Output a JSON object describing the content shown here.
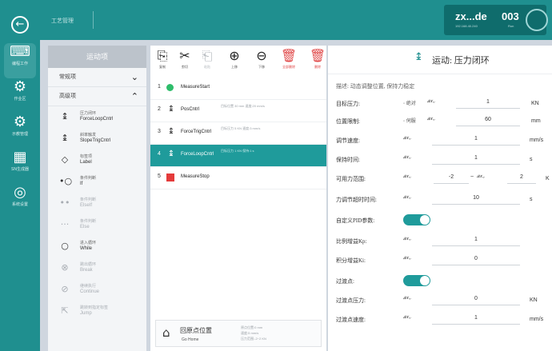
{
  "colors": {
    "accent": "#1f8f8f",
    "selected": "#1f9b9b",
    "danger": "#e04848",
    "start": "#2ebd6b",
    "stop": "#e43b3b"
  },
  "rail": {
    "back_icon": "back-icon",
    "items": [
      {
        "icon": "program-icon",
        "glyph": "⌨",
        "label": "编程工作"
      },
      {
        "icon": "robot-arm-icon",
        "glyph": "⚙",
        "label": "作业区"
      },
      {
        "icon": "devices-icon",
        "glyph": "⚙",
        "label": "示教管理"
      },
      {
        "icon": "barcode-icon",
        "glyph": "▦",
        "label": "SN生成器"
      },
      {
        "icon": "settings-icon",
        "glyph": "◎",
        "label": "系统设置"
      }
    ]
  },
  "topbar": {
    "title": "工艺管理"
  },
  "device": {
    "name": "zx...de",
    "ip": "192.168.40.240",
    "number": "003",
    "number_sub": "Run"
  },
  "left_panel": {
    "title": "运动项",
    "categories": [
      {
        "label": "常规项",
        "chevron": "⌄"
      },
      {
        "label": "高级项",
        "chevron": "⌃"
      }
    ],
    "commands": [
      {
        "icon": "force-loop-icon",
        "glyph": "↨",
        "cn": "压力闭环",
        "en": "ForceLoopCntrl",
        "dim": false
      },
      {
        "icon": "slope-icon",
        "glyph": "↨",
        "cn": "斜率触发",
        "en": "SlopeTrigCntrl",
        "dim": false
      },
      {
        "icon": "label-icon",
        "glyph": "◇",
        "cn": "标签项",
        "en": "Label",
        "dim": false
      },
      {
        "icon": "if-icon",
        "glyph": "•○",
        "cn": "条件判断",
        "en": "If",
        "dim": false
      },
      {
        "icon": "elseif-icon",
        "glyph": "••",
        "cn": "条件判断",
        "en": "ElseIf",
        "dim": true
      },
      {
        "icon": "else-icon",
        "glyph": "···",
        "cn": "条件判断",
        "en": "Else",
        "dim": true
      },
      {
        "icon": "while-icon",
        "glyph": "○",
        "cn": "进入循环",
        "en": "While",
        "dim": false
      },
      {
        "icon": "break-icon",
        "glyph": "⊗",
        "cn": "跳出循环",
        "en": "Break",
        "dim": true
      },
      {
        "icon": "continue-icon",
        "glyph": "⊘",
        "cn": "继续执行",
        "en": "Continue",
        "dim": true
      },
      {
        "icon": "jump-icon",
        "glyph": "⇱",
        "cn": "跳转到指定标签",
        "en": "Jump",
        "dim": true
      }
    ]
  },
  "toolbar": {
    "buttons": [
      {
        "icon": "copy-icon",
        "glyph": "⎘",
        "label": "复制",
        "state": "normal"
      },
      {
        "icon": "cut-icon",
        "glyph": "✂",
        "label": "剪切",
        "state": "normal"
      },
      {
        "icon": "paste-icon",
        "glyph": "⎗",
        "label": "粘贴",
        "state": "disabled"
      },
      {
        "icon": "move-up-icon",
        "glyph": "⊕",
        "label": "上移",
        "state": "normal"
      },
      {
        "icon": "move-down-icon",
        "glyph": "⊖",
        "label": "下移",
        "state": "normal"
      },
      {
        "icon": "delete-all-icon",
        "glyph": "🗑",
        "label": "全部删除",
        "state": "danger"
      },
      {
        "icon": "delete-icon",
        "glyph": "🗑",
        "label": "删除",
        "state": "danger"
      }
    ]
  },
  "program": {
    "rows": [
      {
        "index": "1",
        "icon": "start-icon",
        "glyph": "",
        "style": "green",
        "name": "MeasureStart",
        "detail": "",
        "selected": false
      },
      {
        "index": "2",
        "icon": "pos-icon",
        "glyph": "↨",
        "style": "",
        "name": "PosCntrl",
        "detail": "目标位置 30 mm 速度:20 mm/s",
        "selected": false
      },
      {
        "index": "3",
        "icon": "force-trig-icon",
        "glyph": "↨",
        "style": "",
        "name": "ForceTrigCntrl",
        "detail": "目标压力 5 KN 速度:3 mm/s",
        "selected": false
      },
      {
        "index": "4",
        "icon": "force-loop-icon",
        "glyph": "↨",
        "style": "",
        "name": "ForceLoopCntrl",
        "detail": "目标压力 1 KN 保持:1 s",
        "selected": true
      },
      {
        "index": "5",
        "icon": "stop-icon",
        "glyph": "",
        "style": "red",
        "name": "MeasureStop",
        "detail": "",
        "selected": false
      }
    ],
    "go_home": {
      "icon": "home-icon",
      "glyph": "⌂",
      "cn": "回原点位置",
      "en": "Go Home",
      "info1": "原点位置:0 mm",
      "info2": "速度:5 mm/s",
      "info3": "压力范围:-2~2 KN"
    }
  },
  "params": {
    "icon": "force-loop-icon",
    "title": "运动: 压力闭环",
    "description": "描述: 动态调整位置, 保持力稳定",
    "fields": [
      {
        "key": "target_force",
        "label": "目标压力:",
        "mode": "◦ 绝对",
        "value": "1",
        "unit": "KN"
      },
      {
        "key": "position_limit",
        "label": "位置限制:",
        "mode": "◦ 伺服",
        "value": "60",
        "unit": "mm"
      },
      {
        "key": "adjust_speed",
        "label": "调节速度:",
        "mode": "",
        "value": "1",
        "unit": "mm/s"
      },
      {
        "key": "hold_time",
        "label": "保持时间:",
        "mode": "",
        "value": "1",
        "unit": "s"
      },
      {
        "key": "force_range",
        "label": "可用力范围:",
        "mode": "",
        "value": "-2",
        "value2": "2",
        "unit": "K"
      },
      {
        "key": "adjust_timeout",
        "label": "力调节超时时间:",
        "mode": "",
        "value": "10",
        "unit": "s"
      }
    ],
    "pid": {
      "label": "自定义PID参数:",
      "on": true
    },
    "kp": {
      "label": "比例增益Kp:",
      "value": "1"
    },
    "ki": {
      "label": "积分增益Ki:",
      "value": "0"
    },
    "transition": {
      "label": "过渡点:",
      "on": true
    },
    "transition_force": {
      "label": "过渡点压力:",
      "value": "0",
      "unit": "KN"
    },
    "transition_speed": {
      "label": "过渡点速度:",
      "value": "1",
      "unit": "mm/s"
    },
    "var_select": "𝑎𝑥⌄",
    "tilde": "~"
  }
}
